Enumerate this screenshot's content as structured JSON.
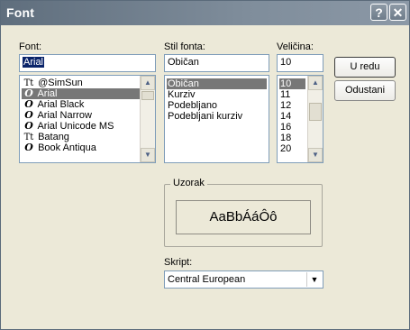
{
  "window": {
    "title": "Font"
  },
  "titlebar": {
    "help_icon": "?",
    "close_icon": "✕"
  },
  "font": {
    "label": "Font:",
    "input_value": "Arial",
    "items": [
      {
        "glyph": "Tt",
        "name": "@SimSun"
      },
      {
        "glyph": "O",
        "name": "Arial"
      },
      {
        "glyph": "O",
        "name": "Arial Black"
      },
      {
        "glyph": "O",
        "name": "Arial Narrow"
      },
      {
        "glyph": "O",
        "name": "Arial Unicode MS"
      },
      {
        "glyph": "Tt",
        "name": "Batang"
      },
      {
        "glyph": "O",
        "name": "Book Antiqua"
      }
    ]
  },
  "style": {
    "label": "Stil fonta:",
    "input_value": "Običan",
    "items": [
      "Običan",
      "Kurziv",
      "Podebljano",
      "Podebljani kurziv"
    ]
  },
  "size": {
    "label": "Veličina:",
    "input_value": "10",
    "items": [
      "10",
      "11",
      "12",
      "14",
      "16",
      "18",
      "20"
    ]
  },
  "buttons": {
    "ok": "U redu",
    "cancel": "Odustani"
  },
  "sample": {
    "label": "Uzorak",
    "text": "AaBbÁáÔô"
  },
  "script": {
    "label": "Skript:",
    "value": "Central European"
  },
  "arrows": {
    "up": "▲",
    "down": "▼"
  }
}
